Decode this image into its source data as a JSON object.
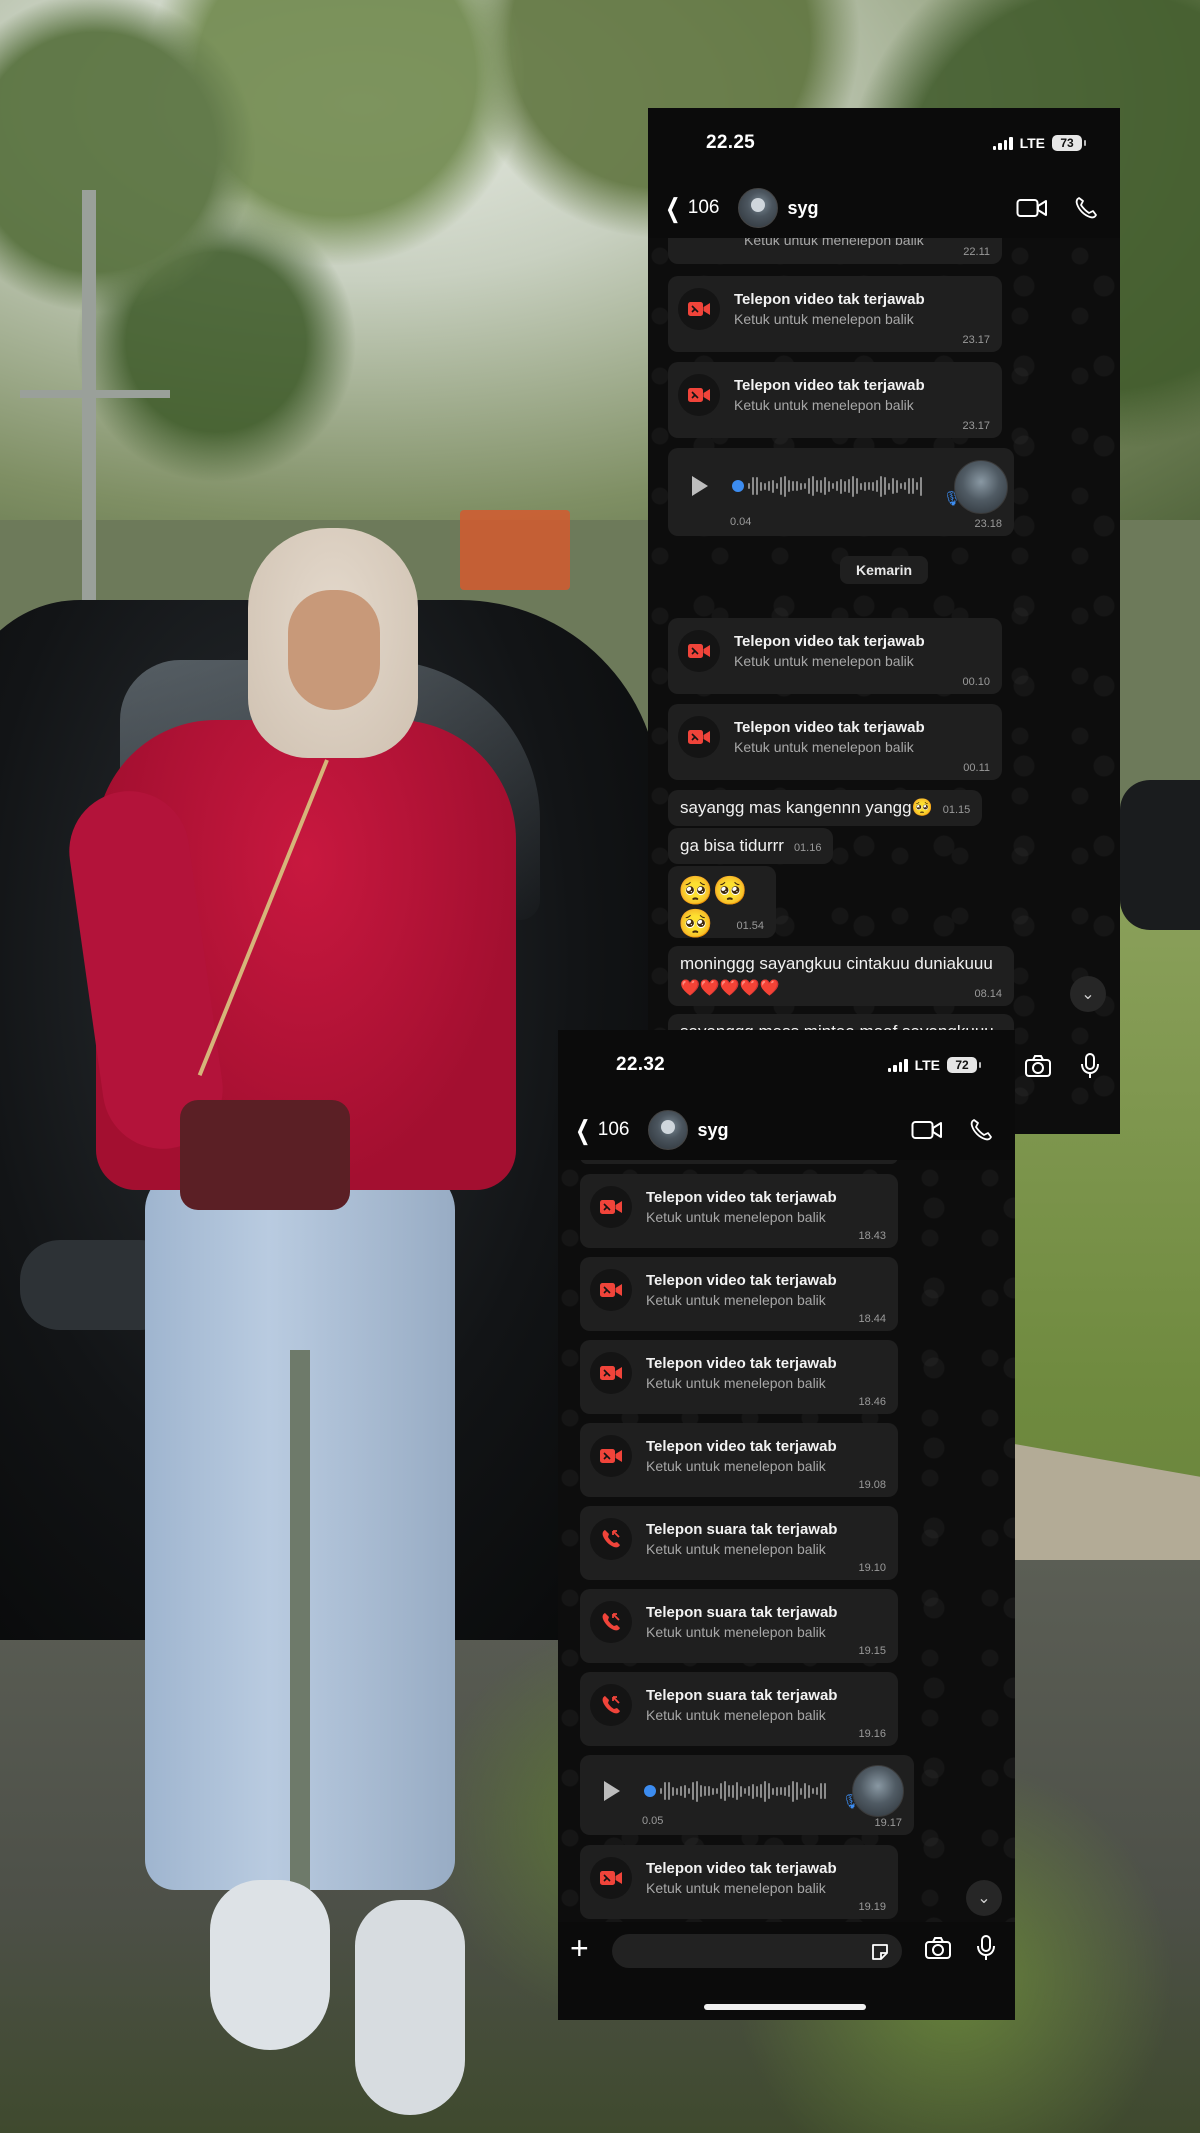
{
  "phone1": {
    "status": {
      "time": "22.25",
      "network": "LTE",
      "battery": "73"
    },
    "nav": {
      "back_count": "106",
      "contact": "syg"
    },
    "partial_top": {
      "subtitle": "Ketuk untuk menelepon balik",
      "time": "22.11"
    },
    "calls_before": [
      {
        "title": "Telepon video tak terjawab",
        "subtitle": "Ketuk untuk menelepon balik",
        "time": "23.17"
      },
      {
        "title": "Telepon video tak terjawab",
        "subtitle": "Ketuk untuk menelepon balik",
        "time": "23.17"
      }
    ],
    "voice": {
      "duration": "0.04",
      "time": "23.18"
    },
    "date_chip": "Kemarin",
    "calls_after": [
      {
        "title": "Telepon video tak terjawab",
        "subtitle": "Ketuk untuk menelepon balik",
        "time": "00.10"
      },
      {
        "title": "Telepon video tak terjawab",
        "subtitle": "Ketuk untuk menelepon balik",
        "time": "00.11"
      }
    ],
    "texts": [
      {
        "text": "sayangg mas kangennn yangg🥺",
        "time": "01.15"
      },
      {
        "text": "ga bisa tidurrr",
        "time": "01.16"
      },
      {
        "text": "🥺🥺🥺",
        "time": "01.54"
      },
      {
        "text": "moninggg sayangkuu cintakuu duniakuuu",
        "text2": "❤️❤️❤️❤️❤️",
        "time": "08.14"
      },
      {
        "text": "sayanggg mass mintaa maaf sayangkuuu",
        "time": ""
      }
    ]
  },
  "phone2": {
    "status": {
      "time": "22.32",
      "network": "LTE",
      "battery": "72"
    },
    "nav": {
      "back_count": "106",
      "contact": "syg"
    },
    "calls": [
      {
        "kind": "video",
        "title": "Telepon video tak terjawab",
        "subtitle": "Ketuk untuk menelepon balik",
        "time": "18.43"
      },
      {
        "kind": "video",
        "title": "Telepon video tak terjawab",
        "subtitle": "Ketuk untuk menelepon balik",
        "time": "18.44"
      },
      {
        "kind": "video",
        "title": "Telepon video tak terjawab",
        "subtitle": "Ketuk untuk menelepon balik",
        "time": "18.46"
      },
      {
        "kind": "video",
        "title": "Telepon video tak terjawab",
        "subtitle": "Ketuk untuk menelepon balik",
        "time": "19.08"
      },
      {
        "kind": "voice",
        "title": "Telepon suara tak terjawab",
        "subtitle": "Ketuk untuk menelepon balik",
        "time": "19.10"
      },
      {
        "kind": "voice",
        "title": "Telepon suara tak terjawab",
        "subtitle": "Ketuk untuk menelepon balik",
        "time": "19.15"
      },
      {
        "kind": "voice",
        "title": "Telepon suara tak terjawab",
        "subtitle": "Ketuk untuk menelepon balik",
        "time": "19.16"
      }
    ],
    "voice": {
      "duration": "0.05",
      "time": "19.17"
    },
    "calls_after": [
      {
        "kind": "video",
        "title": "Telepon video tak terjawab",
        "subtitle": "Ketuk untuk menelepon balik",
        "time": "19.19"
      }
    ],
    "partial_bottom": {
      "title": "Telepon video tak terjawab"
    }
  },
  "icons": {
    "video_call": "video-camera-icon",
    "voice_call": "phone-icon",
    "missed_video": "missed-video-call-icon",
    "missed_voice": "missed-voice-call-icon",
    "camera": "camera-icon",
    "mic": "microphone-icon",
    "sticker": "sticker-icon",
    "plus": "plus-icon",
    "chevron": "chevron-down-icon"
  },
  "colors": {
    "missed": "#f0443a",
    "voice_accent": "#3c8cf0",
    "bubble": "#1f1f1f",
    "chat_bg": "#0d0d0d"
  }
}
